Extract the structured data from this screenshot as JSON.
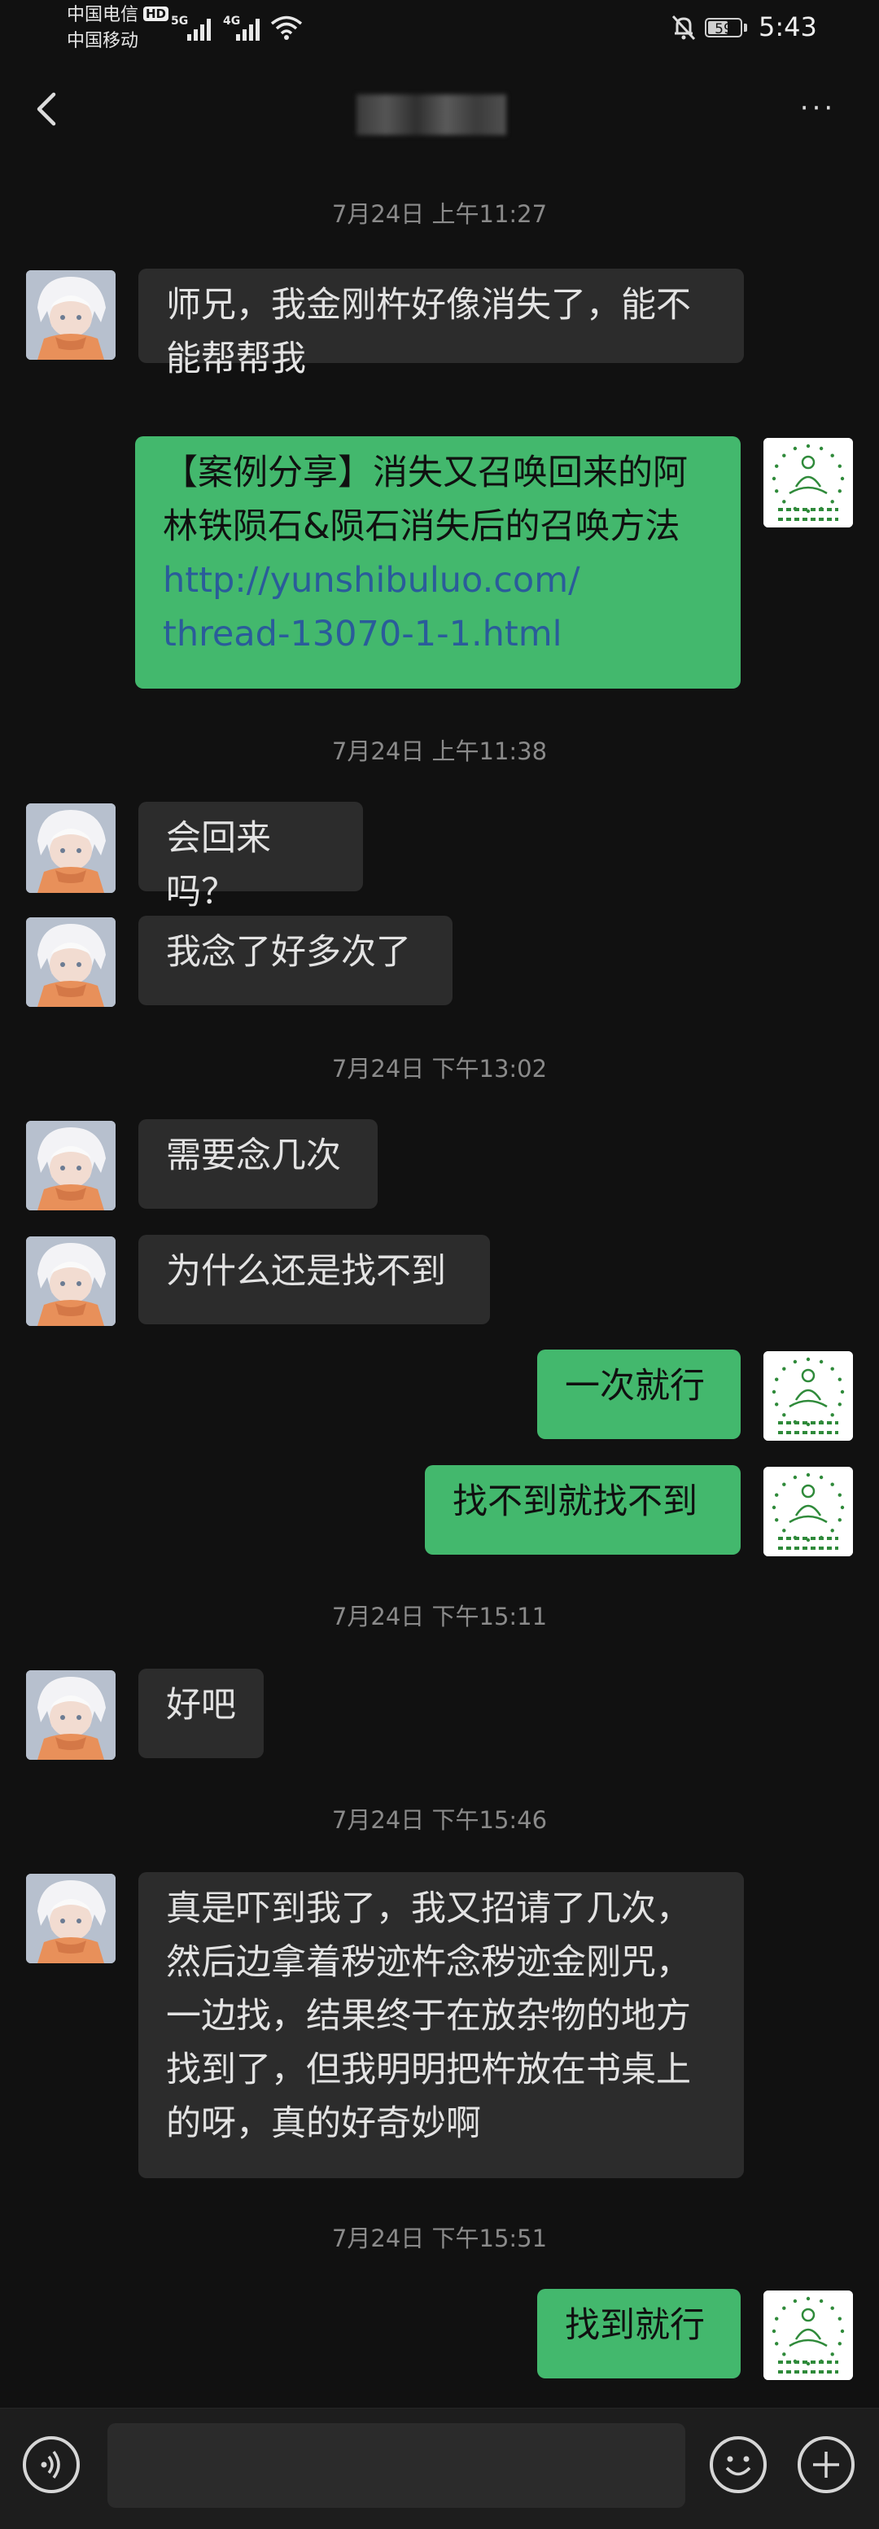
{
  "status_bar": {
    "carrier1": "中国电信",
    "carrier2": "中国移动",
    "hd": "HD",
    "net1": "5G",
    "net2": "4G",
    "battery": "59",
    "time": "5:43"
  },
  "nav": {
    "icons": [
      "back-arrow-icon",
      "more-icon"
    ],
    "more": "···"
  },
  "messages": [
    {
      "type": "time",
      "text": "7月24日 上午11:27"
    },
    {
      "type": "msg",
      "side": "left",
      "lines": [
        "师兄，我金刚杵好像消失了，能不",
        "能帮帮我"
      ]
    },
    {
      "type": "msg",
      "side": "right",
      "lines": [
        "【案例分享】消失又召唤回来的阿",
        "林铁陨石&陨石消失后的召唤方法"
      ],
      "link": [
        "http://yunshibuluo.com/",
        "thread-13070-1-1.html"
      ]
    },
    {
      "type": "time",
      "text": "7月24日 上午11:38"
    },
    {
      "type": "msg",
      "side": "left",
      "lines": [
        "会回来吗？"
      ]
    },
    {
      "type": "msg",
      "side": "left",
      "lines": [
        "我念了好多次了"
      ]
    },
    {
      "type": "time",
      "text": "7月24日 下午13:02"
    },
    {
      "type": "msg",
      "side": "left",
      "lines": [
        "需要念几次"
      ]
    },
    {
      "type": "msg",
      "side": "left",
      "lines": [
        "为什么还是找不到"
      ]
    },
    {
      "type": "msg",
      "side": "right",
      "lines": [
        "一次就行"
      ]
    },
    {
      "type": "msg",
      "side": "right",
      "lines": [
        "找不到就找不到"
      ]
    },
    {
      "type": "time",
      "text": "7月24日 下午15:11"
    },
    {
      "type": "msg",
      "side": "left",
      "lines": [
        "好吧"
      ]
    },
    {
      "type": "time",
      "text": "7月24日 下午15:46"
    },
    {
      "type": "msg",
      "side": "left",
      "lines": [
        "真是吓到我了，我又招请了几次，",
        "然后边拿着秽迹杵念秽迹金刚咒，",
        "一边找，结果终于在放杂物的地方",
        "找到了，但我明明把杵放在书桌上",
        "的呀，真的好奇妙啊"
      ]
    },
    {
      "type": "time",
      "text": "7月24日 下午15:51"
    },
    {
      "type": "msg",
      "side": "right",
      "lines": [
        "找到就行"
      ]
    }
  ],
  "input_bar": {
    "icons": [
      "voice-icon",
      "emoji-icon",
      "plus-icon"
    ]
  },
  "colors": {
    "background": "#111111",
    "received_bubble": "#2c2c2c",
    "sent_bubble": "#43b86d",
    "link": "#2a5c9a"
  }
}
